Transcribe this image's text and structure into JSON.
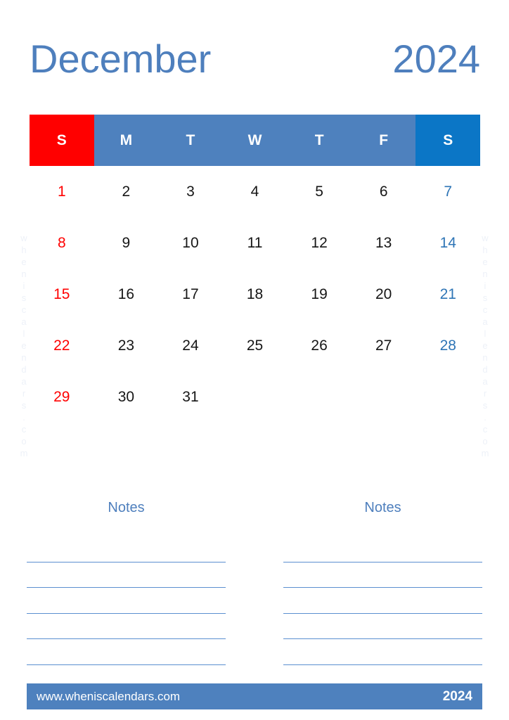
{
  "title": {
    "month": "December",
    "year": "2024",
    "color": "#4E7FBD"
  },
  "calendar": {
    "weekday_headers": [
      {
        "label": "S",
        "kind": "sun"
      },
      {
        "label": "M",
        "kind": "weekday"
      },
      {
        "label": "T",
        "kind": "weekday"
      },
      {
        "label": "W",
        "kind": "weekday"
      },
      {
        "label": "T",
        "kind": "weekday"
      },
      {
        "label": "F",
        "kind": "weekday"
      },
      {
        "label": "S",
        "kind": "sat"
      }
    ],
    "header_colors": {
      "sunday": "#FF0000",
      "weekday": "#4E81BE",
      "saturday": "#0B76C6",
      "text": "#FFFFFF"
    },
    "date_colors": {
      "sunday": "#FF0000",
      "weekday": "#161616",
      "saturday": "#2E75B6"
    },
    "weeks": [
      [
        "1",
        "2",
        "3",
        "4",
        "5",
        "6",
        "7"
      ],
      [
        "8",
        "9",
        "10",
        "11",
        "12",
        "13",
        "14"
      ],
      [
        "15",
        "16",
        "17",
        "18",
        "19",
        "20",
        "21"
      ],
      [
        "22",
        "23",
        "24",
        "25",
        "26",
        "27",
        "28"
      ],
      [
        "29",
        "30",
        "31",
        "",
        "",
        "",
        ""
      ]
    ]
  },
  "watermark": {
    "text": "wheniscalendars.com",
    "color": "#EDF1F8"
  },
  "notes": {
    "columns": [
      {
        "heading": "Notes",
        "line_count": 5
      },
      {
        "heading": "Notes",
        "line_count": 5
      }
    ],
    "heading_color": "#4E7FBD",
    "line_color": "#5B8FD0"
  },
  "footer": {
    "url": "www.wheniscalendars.com",
    "year": "2024",
    "background": "#4E81BE",
    "text_color": "#FFFFFF"
  }
}
